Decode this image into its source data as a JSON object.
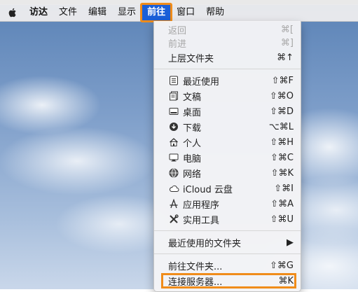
{
  "menubar": {
    "items": [
      "访达",
      "文件",
      "编辑",
      "显示",
      "前往",
      "窗口",
      "帮助"
    ],
    "active_index": 4
  },
  "go_menu": {
    "nav": [
      {
        "label": "返回",
        "shortcut": "⌘[",
        "enabled": false
      },
      {
        "label": "前进",
        "shortcut": "⌘]",
        "enabled": false
      },
      {
        "label": "上层文件夹",
        "shortcut": "⌘↑",
        "enabled": true
      }
    ],
    "places": [
      {
        "label": "最近使用",
        "shortcut": "⇧⌘F",
        "icon": "recents-icon"
      },
      {
        "label": "文稿",
        "shortcut": "⇧⌘O",
        "icon": "documents-icon"
      },
      {
        "label": "桌面",
        "shortcut": "⇧⌘D",
        "icon": "desktop-icon"
      },
      {
        "label": "下载",
        "shortcut": "⌥⌘L",
        "icon": "downloads-icon"
      },
      {
        "label": "个人",
        "shortcut": "⇧⌘H",
        "icon": "home-icon"
      },
      {
        "label": "电脑",
        "shortcut": "⇧⌘C",
        "icon": "computer-icon"
      },
      {
        "label": "网络",
        "shortcut": "⇧⌘K",
        "icon": "network-icon"
      },
      {
        "label": "iCloud 云盘",
        "shortcut": "⇧⌘I",
        "icon": "icloud-icon"
      },
      {
        "label": "应用程序",
        "shortcut": "⇧⌘A",
        "icon": "applications-icon"
      },
      {
        "label": "实用工具",
        "shortcut": "⇧⌘U",
        "icon": "utilities-icon"
      }
    ],
    "recent_folders": {
      "label": "最近使用的文件夹",
      "submenu_indicator": "▶"
    },
    "goto_folder": {
      "label": "前往文件夹...",
      "shortcut": "⇧⌘G"
    },
    "connect_server": {
      "label": "连接服务器...",
      "shortcut": "⌘K"
    }
  },
  "colors": {
    "highlight_outline": "#f08c1a",
    "active_menu_bg": "#1a5fd8"
  }
}
